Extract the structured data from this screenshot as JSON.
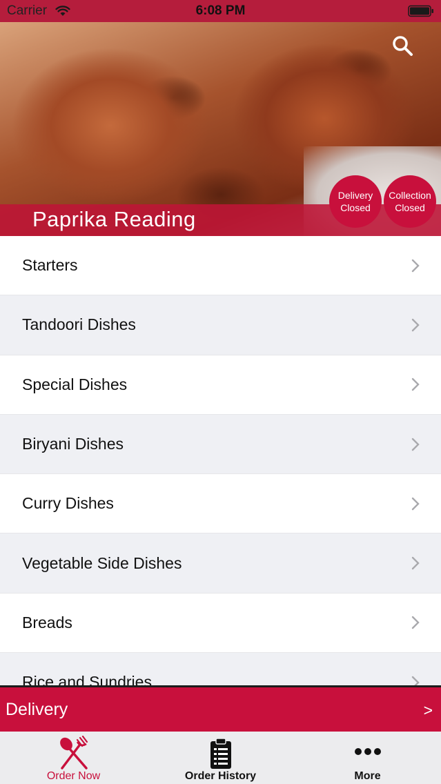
{
  "status_bar": {
    "carrier": "Carrier",
    "time": "6:08 PM",
    "icons": [
      "wifi-icon",
      "battery-icon"
    ]
  },
  "header": {
    "restaurant_name": "Paprika Reading",
    "search_icon": "search-icon",
    "delivery_status": {
      "line1": "Delivery",
      "line2": "Closed"
    },
    "collection_status": {
      "line1": "Collection",
      "line2": "Closed"
    }
  },
  "menu": {
    "items": [
      {
        "label": "Starters"
      },
      {
        "label": "Tandoori Dishes"
      },
      {
        "label": "Special Dishes"
      },
      {
        "label": "Biryani Dishes"
      },
      {
        "label": "Curry Dishes"
      },
      {
        "label": "Vegetable Side Dishes"
      },
      {
        "label": "Breads"
      },
      {
        "label": "Rice and Sundries"
      }
    ],
    "row_icon": "chevron-right-icon"
  },
  "delivery_bar": {
    "label": "Delivery",
    "arrow": ">"
  },
  "tab_bar": {
    "tabs": [
      {
        "label": "Order Now",
        "icon": "fork-knife-icon",
        "active": true
      },
      {
        "label": "Order History",
        "icon": "clipboard-list-icon",
        "active": false
      },
      {
        "label": "More",
        "icon": "more-dots-icon",
        "active": false
      }
    ]
  },
  "colors": {
    "brand_red": "#c8103c",
    "status_bar": "#b51d3c",
    "row_alt": "#eff0f4",
    "tab_bar": "#ececee"
  }
}
